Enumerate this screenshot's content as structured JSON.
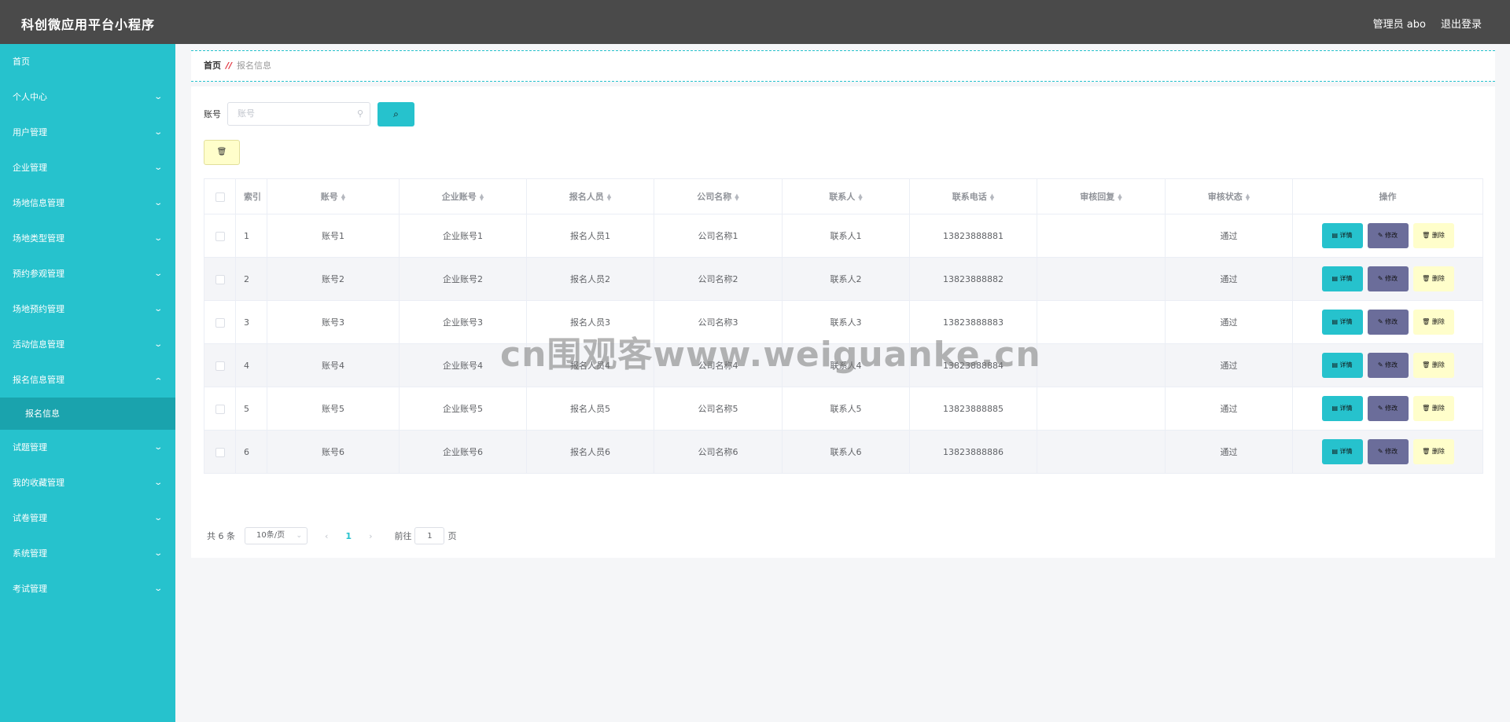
{
  "header": {
    "title": "科创微应用平台小程序",
    "user_label": "管理员 abo",
    "logout_label": "退出登录"
  },
  "sidebar": {
    "items": [
      {
        "label": "首页",
        "expandable": false
      },
      {
        "label": "个人中心",
        "expandable": true
      },
      {
        "label": "用户管理",
        "expandable": true
      },
      {
        "label": "企业管理",
        "expandable": true
      },
      {
        "label": "场地信息管理",
        "expandable": true
      },
      {
        "label": "场地类型管理",
        "expandable": true
      },
      {
        "label": "预约参观管理",
        "expandable": true
      },
      {
        "label": "场地预约管理",
        "expandable": true
      },
      {
        "label": "活动信息管理",
        "expandable": true
      },
      {
        "label": "报名信息管理",
        "expandable": true,
        "expanded": true
      },
      {
        "label": "试题管理",
        "expandable": true
      },
      {
        "label": "我的收藏管理",
        "expandable": true
      },
      {
        "label": "试卷管理",
        "expandable": true
      },
      {
        "label": "系统管理",
        "expandable": true
      },
      {
        "label": "考试管理",
        "expandable": true
      }
    ],
    "active_subitem": "报名信息"
  },
  "breadcrumb": {
    "home": "首页",
    "separator": "//",
    "current": "报名信息"
  },
  "search": {
    "label": "账号",
    "placeholder": "账号",
    "value": ""
  },
  "table": {
    "columns": [
      "索引",
      "账号",
      "企业账号",
      "报名人员",
      "公司名称",
      "联系人",
      "联系电话",
      "审核回复",
      "审核状态",
      "操作"
    ],
    "rows": [
      {
        "index": "1",
        "account": "账号1",
        "company_account": "企业账号1",
        "person": "报名人员1",
        "company": "公司名称1",
        "contact": "联系人1",
        "phone": "13823888881",
        "reply": "",
        "status": "通过"
      },
      {
        "index": "2",
        "account": "账号2",
        "company_account": "企业账号2",
        "person": "报名人员2",
        "company": "公司名称2",
        "contact": "联系人2",
        "phone": "13823888882",
        "reply": "",
        "status": "通过"
      },
      {
        "index": "3",
        "account": "账号3",
        "company_account": "企业账号3",
        "person": "报名人员3",
        "company": "公司名称3",
        "contact": "联系人3",
        "phone": "13823888883",
        "reply": "",
        "status": "通过"
      },
      {
        "index": "4",
        "account": "账号4",
        "company_account": "企业账号4",
        "person": "报名人员4",
        "company": "公司名称4",
        "contact": "联系人4",
        "phone": "13823888884",
        "reply": "",
        "status": "通过"
      },
      {
        "index": "5",
        "account": "账号5",
        "company_account": "企业账号5",
        "person": "报名人员5",
        "company": "公司名称5",
        "contact": "联系人5",
        "phone": "13823888885",
        "reply": "",
        "status": "通过"
      },
      {
        "index": "6",
        "account": "账号6",
        "company_account": "企业账号6",
        "person": "报名人员6",
        "company": "公司名称6",
        "contact": "联系人6",
        "phone": "13823888886",
        "reply": "",
        "status": "通过"
      }
    ],
    "actions": {
      "detail": "详情",
      "edit": "修改",
      "delete": "删除"
    }
  },
  "pagination": {
    "total_text": "共 6 条",
    "page_size": "10条/页",
    "current_page": "1",
    "goto_label": "前往",
    "goto_value": "1",
    "page_suffix": "页"
  },
  "watermark": "cn围观客www.weiguanke.cn",
  "colors": {
    "header_bg": "#4a4a4a",
    "sidebar_bg": "#26c2cd",
    "sidebar_active_bg": "#1aa3ad",
    "detail_button": "#26c2cd",
    "edit_button": "#6b6d9a",
    "delete_button": "#fffecb"
  },
  "icons": {
    "search": "magnifier-icon",
    "delete": "trash-icon",
    "detail": "document-icon",
    "edit": "pencil-icon",
    "sort": "sort-caret-icon",
    "chevron": "chevron-down-icon"
  }
}
